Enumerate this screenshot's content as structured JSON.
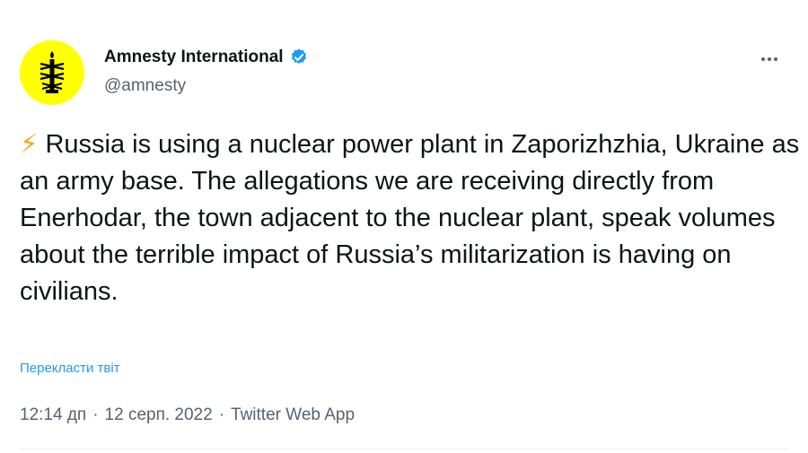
{
  "author": {
    "display_name": "Amnesty International",
    "handle": "@amnesty",
    "avatar_color": "#ffff00",
    "verified": true,
    "verified_color": "#1d9bf0"
  },
  "tweet": {
    "emoji": "⚡",
    "text": "Russia is using a nuclear power plant in Zaporizhzhia, Ukraine as an army base. The allegations we are receiving directly from Enerhodar, the town adjacent to the nuclear plant, speak volumes about the terrible impact of Russia’s militarization is having on civilians.",
    "translate_label": "Перекласти твіт"
  },
  "meta": {
    "time": "12:14 дп",
    "date": "12 серп. 2022",
    "source": "Twitter Web App",
    "separator": "·"
  },
  "icons": {
    "more": "more-options-icon",
    "verified": "verified-badge-icon",
    "emoji": "lightning-emoji"
  }
}
